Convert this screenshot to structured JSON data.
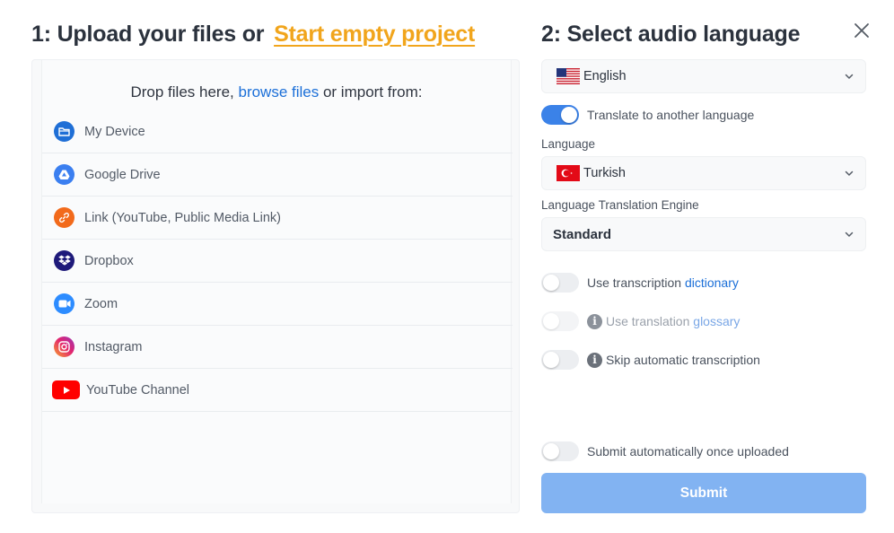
{
  "upload": {
    "title_prefix": "1: Upload your files or ",
    "title_link": "Start empty project",
    "drop_prefix": "Drop files here, ",
    "drop_link": "browse files",
    "drop_suffix": " or import from:",
    "sources": [
      {
        "label": "My Device",
        "icon": "folder-icon",
        "color": "#1f6fd6"
      },
      {
        "label": "Google Drive",
        "icon": "google-drive-icon",
        "color": "#3b7ff0"
      },
      {
        "label": "Link (YouTube, Public Media Link)",
        "icon": "link-icon",
        "color": "#f26a1b"
      },
      {
        "label": "Dropbox",
        "icon": "dropbox-icon",
        "color": "#1e1a7a"
      },
      {
        "label": "Zoom",
        "icon": "zoom-icon",
        "color": "#2d8cff"
      },
      {
        "label": "Instagram",
        "icon": "instagram-icon",
        "color": "#e2246f"
      },
      {
        "label": "YouTube Channel",
        "icon": "youtube-icon",
        "color": "#ff0000"
      }
    ]
  },
  "settings": {
    "title": "2: Select audio language",
    "audio_language": {
      "value": "English",
      "flag": "us-flag-icon"
    },
    "translate_toggle": {
      "label": "Translate to another language",
      "on": true
    },
    "language_label": "Language",
    "target_language": {
      "value": "Turkish",
      "flag": "turkey-flag-icon"
    },
    "engine_label": "Language Translation Engine",
    "engine": {
      "value": "Standard"
    },
    "dictionary_toggle": {
      "label": "Use transcription ",
      "link": "dictionary",
      "on": false
    },
    "glossary_toggle": {
      "label": "Use translation ",
      "link": "glossary",
      "on": false,
      "disabled": true
    },
    "skip_toggle": {
      "label": "Skip automatic transcription",
      "on": false
    },
    "auto_submit_toggle": {
      "label": "Submit automatically once uploaded",
      "on": false
    },
    "submit_label": "Submit"
  },
  "colors": {
    "accent": "#3b82e8",
    "link_orange": "#f1a51c",
    "link_blue": "#1b6fd8",
    "submit_bg": "#82b3f2"
  }
}
